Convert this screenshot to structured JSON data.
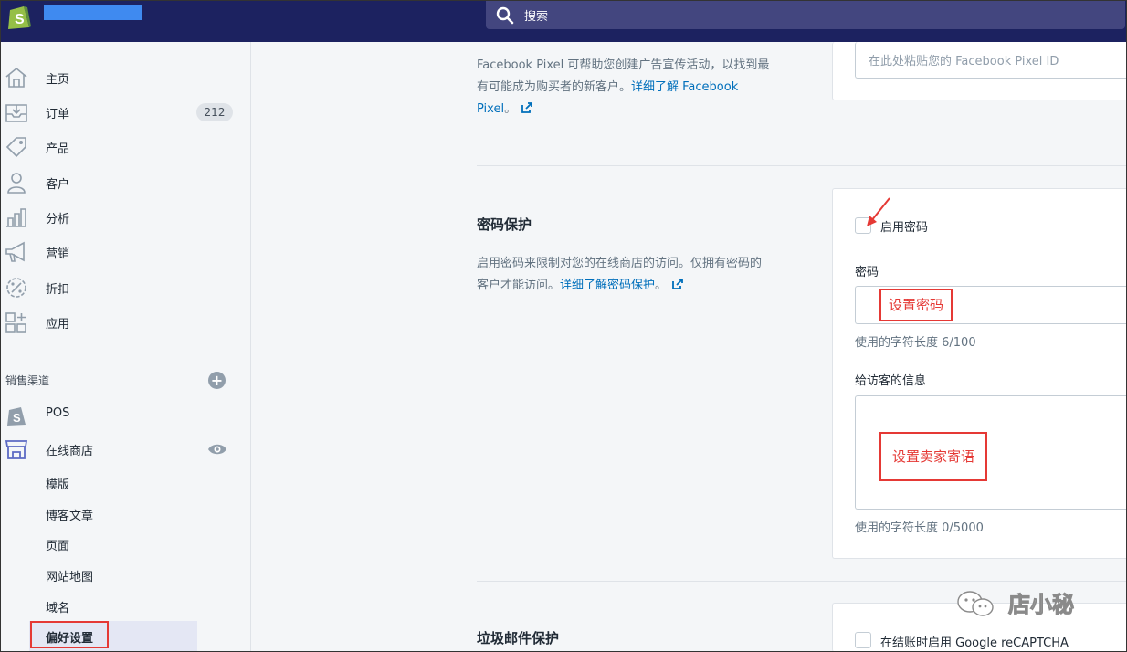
{
  "topbar": {
    "search_placeholder": "搜索"
  },
  "sidebar": {
    "items": [
      {
        "label": "主页",
        "icon": "home-icon"
      },
      {
        "label": "订单",
        "icon": "orders-icon",
        "badge": "212"
      },
      {
        "label": "产品",
        "icon": "tag-icon"
      },
      {
        "label": "客户",
        "icon": "person-icon"
      },
      {
        "label": "分析",
        "icon": "bar-chart-icon"
      },
      {
        "label": "营销",
        "icon": "megaphone-icon"
      },
      {
        "label": "折扣",
        "icon": "discount-icon"
      },
      {
        "label": "应用",
        "icon": "apps-icon"
      }
    ],
    "sales_channels_title": "销售渠道",
    "channels": [
      {
        "label": "POS",
        "icon": "shopify-bag-icon"
      },
      {
        "label": "在线商店",
        "icon": "storefront-icon"
      }
    ],
    "online_store_sub": [
      "模版",
      "博客文章",
      "页面",
      "网站地图",
      "域名"
    ],
    "active_item": "偏好设置"
  },
  "facebook": {
    "desc_line1": "Facebook Pixel 可帮助您创建广告宣传活动，以找到最",
    "desc_line2": "有可能成为购买者的新客户。",
    "link_part1": "详细了解 Facebook",
    "link_part2": "Pixel",
    "desc_end": "。",
    "input_placeholder": "在此处粘贴您的 Facebook Pixel ID"
  },
  "password": {
    "heading": "密码保护",
    "desc_line1": "启用密码来限制对您的在线商店的访问。仅拥有密码的",
    "desc_line2": "客户才能访问。",
    "link": "详细了解密码保护",
    "desc_end": "。",
    "enable_label": "启用密码",
    "password_label": "密码",
    "password_annotation": "设置密码",
    "password_help": "使用的字符长度 6/100",
    "message_label": "给访客的信息",
    "message_annotation": "设置卖家寄语",
    "message_help": "使用的字符长度 0/5000"
  },
  "spam": {
    "heading": "垃圾邮件保护",
    "recaptcha_label": "在结账时启用 Google reCAPTCHA"
  },
  "watermark": {
    "text": "店小秘"
  },
  "colors": {
    "topbar": "#1c2260",
    "link": "#006fbb",
    "annotation": "#e53935"
  }
}
